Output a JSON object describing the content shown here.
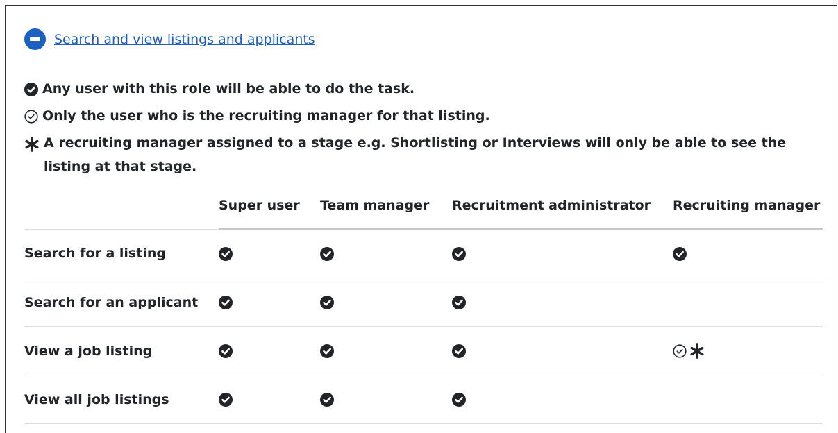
{
  "section": {
    "title": "Search and view listings and applicants",
    "collapse_icon": "minus-circle-icon"
  },
  "legend": [
    {
      "icon": "check-circle-filled-icon",
      "text": "Any user with this role will be able to do the task."
    },
    {
      "icon": "check-circle-outline-icon",
      "text": "Only the user who is the recruiting manager for that listing."
    },
    {
      "icon": "asterisk-icon",
      "text": "A recruiting manager assigned to a stage e.g. Shortlisting or Interviews will only be able to see the listing at that stage."
    }
  ],
  "table": {
    "columns": [
      "Super user",
      "Team manager",
      "Recruitment administrator",
      "Recruiting manager"
    ],
    "rows": [
      {
        "label": "Search for a listing",
        "cells": [
          [
            "full"
          ],
          [
            "full"
          ],
          [
            "full"
          ],
          [
            "full"
          ]
        ]
      },
      {
        "label": "Search for an applicant",
        "cells": [
          [
            "full"
          ],
          [
            "full"
          ],
          [
            "full"
          ],
          []
        ]
      },
      {
        "label": "View a job listing",
        "cells": [
          [
            "full"
          ],
          [
            "full"
          ],
          [
            "full"
          ],
          [
            "outline",
            "asterisk"
          ]
        ]
      },
      {
        "label": "View all job listings",
        "cells": [
          [
            "full"
          ],
          [
            "full"
          ],
          [
            "full"
          ],
          []
        ]
      }
    ]
  },
  "colors": {
    "accent": "#1d60c4",
    "icon": "#212529"
  }
}
